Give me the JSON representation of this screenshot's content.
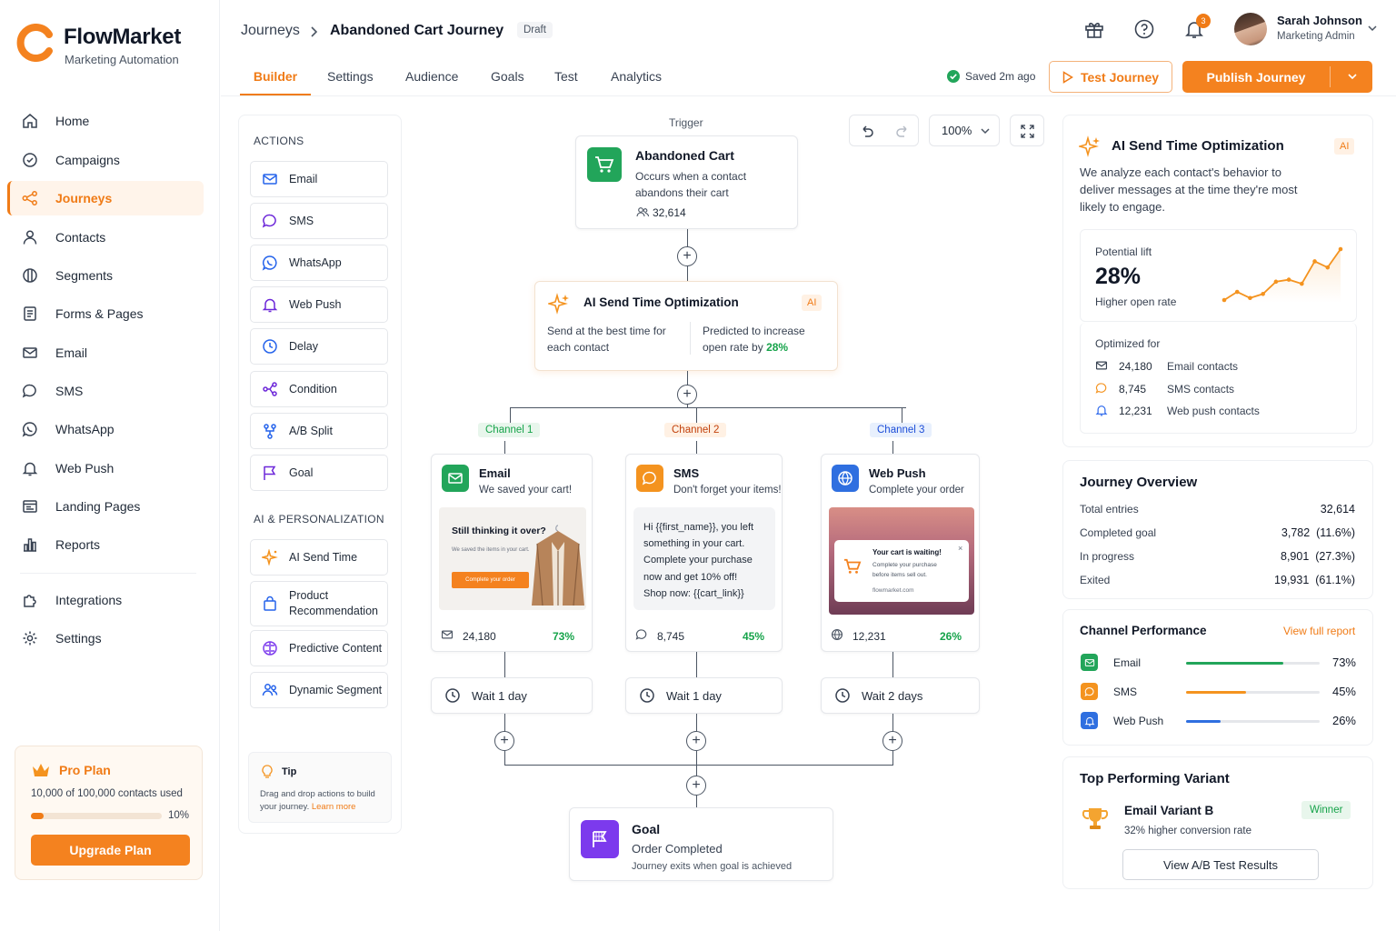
{
  "brand": {
    "name": "FlowMarket",
    "subtitle": "Marketing Automation"
  },
  "nav": [
    {
      "label": "Home",
      "icon": "home-icon"
    },
    {
      "label": "Campaigns",
      "icon": "campaign-icon"
    },
    {
      "label": "Journeys",
      "icon": "journey-icon",
      "active": true
    },
    {
      "label": "Contacts",
      "icon": "user-icon"
    },
    {
      "label": "Segments",
      "icon": "segment-icon"
    },
    {
      "label": "Forms & Pages",
      "icon": "form-icon"
    },
    {
      "label": "Email",
      "icon": "mail-icon"
    },
    {
      "label": "SMS",
      "icon": "chat-icon"
    },
    {
      "label": "WhatsApp",
      "icon": "whatsapp-icon"
    },
    {
      "label": "Web Push",
      "icon": "bell-icon"
    },
    {
      "label": "Landing Pages",
      "icon": "landing-icon"
    },
    {
      "label": "Reports",
      "icon": "chart-icon"
    }
  ],
  "nav_bottom": [
    {
      "label": "Integrations",
      "icon": "puzzle-icon"
    },
    {
      "label": "Settings",
      "icon": "gear-icon"
    }
  ],
  "plan": {
    "title": "Pro Plan",
    "usage": "10,000 of 100,000 contacts used",
    "percent": "10%",
    "fill_fraction": 0.1,
    "button": "Upgrade Plan"
  },
  "header": {
    "breadcrumb_parent": "Journeys",
    "breadcrumb_current": "Abandoned Cart Journey",
    "status": "Draft",
    "notification_count": "3",
    "user_name": "Sarah Johnson",
    "user_role": "Marketing Admin",
    "saved": "Saved 2m ago",
    "test_button": "Test Journey",
    "publish_button": "Publish Journey"
  },
  "tabs": [
    "Builder",
    "Settings",
    "Audience",
    "Goals",
    "Test",
    "Analytics"
  ],
  "actions_panel": {
    "actions_title": "ACTIONS",
    "actions": [
      {
        "label": "Email",
        "icon": "mail-icon"
      },
      {
        "label": "SMS",
        "icon": "chat-icon"
      },
      {
        "label": "WhatsApp",
        "icon": "whatsapp-icon"
      },
      {
        "label": "Web Push",
        "icon": "bell-icon"
      },
      {
        "label": "Delay",
        "icon": "clock-icon"
      },
      {
        "label": "Condition",
        "icon": "condition-icon"
      },
      {
        "label": "A/B Split",
        "icon": "split-icon"
      },
      {
        "label": "Goal",
        "icon": "flag-icon"
      }
    ],
    "ai_title": "AI & PERSONALIZATION",
    "ai_actions": [
      {
        "label": "AI Send Time",
        "icon": "sparkle-icon"
      },
      {
        "label": "Product Recommendation",
        "icon": "bag-icon"
      },
      {
        "label": "Predictive Content",
        "icon": "brain-icon"
      },
      {
        "label": "Dynamic Segment",
        "icon": "users-icon"
      }
    ],
    "tip_title": "Tip",
    "tip_text": "Drag and drop actions to build your journey.",
    "tip_link": "Learn more"
  },
  "canvas": {
    "zoom": "100%",
    "trigger_label": "Trigger",
    "trigger": {
      "title": "Abandoned Cart",
      "desc": "Occurs when a contact abandons their cart",
      "count": "32,614"
    },
    "ai_node": {
      "title": "AI Send Time Optimization",
      "chip": "AI",
      "left": "Send at the best time for each contact",
      "right_prefix": "Predicted to increase open rate by ",
      "right_value": "28%"
    },
    "channels": [
      {
        "tag": "Channel 1",
        "title": "Email",
        "subtitle": "We saved your cart!",
        "count": "24,180",
        "rate": "73%",
        "wait": "Wait 1 day",
        "preview_title": "Still thinking it over?",
        "preview_text": "We saved the items in your cart.",
        "preview_button": "Complete your order"
      },
      {
        "tag": "Channel 2",
        "title": "SMS",
        "subtitle": "Don't forget your items!",
        "count": "8,745",
        "rate": "45%",
        "wait": "Wait 1 day",
        "sms_lines": [
          "Hi {{first_name}}, you left",
          "something in your cart.",
          "Complete your purchase",
          "now and get 10% off!",
          "Shop now: {{cart_link}}"
        ]
      },
      {
        "tag": "Channel 3",
        "title": "Web Push",
        "subtitle": "Complete your order",
        "count": "12,231",
        "rate": "26%",
        "wait": "Wait 2 days",
        "push_title": "Your cart is waiting!",
        "push_text": "Complete your purchase before items sell out.",
        "push_domain": "flowmarket.com"
      }
    ],
    "goal": {
      "title": "Goal",
      "subtitle": "Order Completed",
      "desc": "Journey exits when goal is achieved"
    }
  },
  "right": {
    "ai_card": {
      "title": "AI Send Time Optimization",
      "chip": "AI",
      "desc": "We analyze each contact's behavior to deliver messages at the time they're most likely to engage.",
      "lift_label": "Potential lift",
      "lift_value": "28%",
      "lift_sub": "Higher open rate",
      "sparkline": [
        2,
        6,
        3,
        5,
        11,
        12,
        10,
        21,
        18,
        27
      ],
      "optimized_title": "Optimized for",
      "optimized": [
        {
          "count": "24,180",
          "label": "Email contacts",
          "icon": "mail-icon"
        },
        {
          "count": "8,745",
          "label": "SMS contacts",
          "icon": "chat-icon"
        },
        {
          "count": "12,231",
          "label": "Web push contacts",
          "icon": "bell-icon"
        }
      ]
    },
    "overview": {
      "title": "Journey Overview",
      "rows": [
        {
          "label": "Total entries",
          "value": "32,614"
        },
        {
          "label": "Completed goal",
          "value": "3,782  (11.6%)"
        },
        {
          "label": "In progress",
          "value": "8,901  (27.3%)"
        },
        {
          "label": "Exited",
          "value": "19,931  (61.1%)"
        }
      ]
    },
    "performance": {
      "title": "Channel Performance",
      "link": "View full report",
      "rows": [
        {
          "label": "Email",
          "value": "73%",
          "fraction": 0.73,
          "color": "#22a55a"
        },
        {
          "label": "SMS",
          "value": "45%",
          "fraction": 0.45,
          "color": "#f4931f"
        },
        {
          "label": "Web Push",
          "value": "26%",
          "fraction": 0.26,
          "color": "#2f6fe0"
        }
      ]
    },
    "variant": {
      "title": "Top Performing Variant",
      "name": "Email Variant B",
      "badge": "Winner",
      "desc": "32% higher conversion rate",
      "button": "View A/B Test Results"
    }
  },
  "colors": {
    "accent": "#f07b16",
    "green": "#22a55a",
    "blue": "#2f6fe0",
    "purple": "#7c3aed"
  }
}
